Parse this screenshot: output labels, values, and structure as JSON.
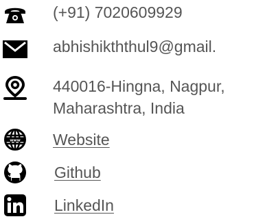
{
  "contacts": {
    "phone": {
      "icon": "phone-icon",
      "text": "(+91) 7020609929"
    },
    "email": {
      "icon": "envelope-icon",
      "text": "abhishikththul9@gmail."
    },
    "address": {
      "icon": "location-pin-icon",
      "line1": "440016-Hingna, Nagpur,",
      "line2": "Maharashtra, India"
    },
    "website": {
      "icon": "globe-icon",
      "label": "Website"
    },
    "github": {
      "icon": "github-icon",
      "label": "Github"
    },
    "linkedin": {
      "icon": "linkedin-icon",
      "label": "LinkedIn"
    }
  },
  "colors": {
    "icon": "#000000",
    "text": "#555555",
    "background": "#ffffff"
  }
}
